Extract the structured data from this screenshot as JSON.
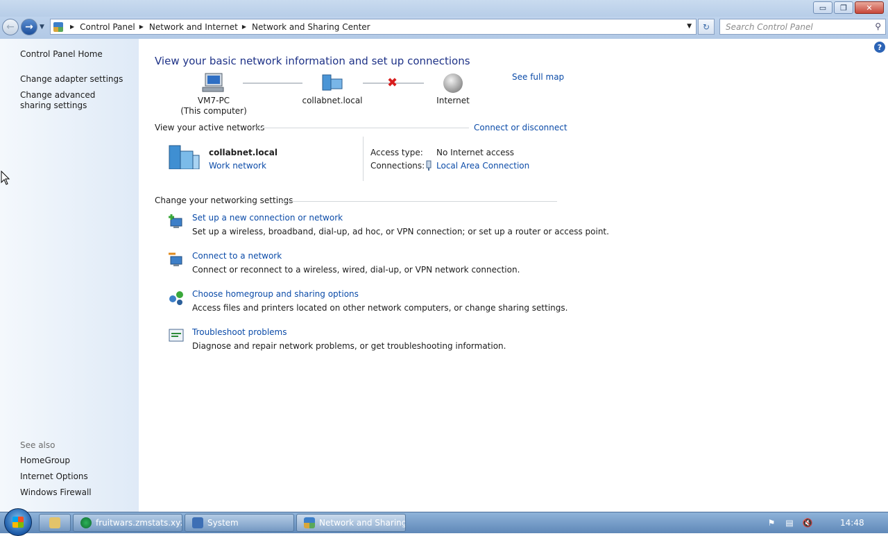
{
  "window": {
    "minimize_glyph": "▭",
    "maximize_glyph": "❐",
    "close_glyph": "✕"
  },
  "addressbar": {
    "crumbs": [
      "Control Panel",
      "Network and Internet",
      "Network and Sharing Center"
    ],
    "search_placeholder": "Search Control Panel"
  },
  "sidebar": {
    "home": "Control Panel Home",
    "items": [
      "Change adapter settings",
      "Change advanced sharing settings"
    ],
    "see_also_label": "See also",
    "see_also": [
      "HomeGroup",
      "Internet Options",
      "Windows Firewall"
    ]
  },
  "main": {
    "title": "View your basic network information and set up connections",
    "see_full_map": "See full map",
    "map": {
      "computer_name": "VM7-PC",
      "computer_sub": "(This computer)",
      "network_name": "collabnet.local",
      "internet": "Internet"
    },
    "active_networks": {
      "heading": "View your active networks",
      "connect_link": "Connect or disconnect",
      "network_name": "collabnet.local",
      "network_type": "Work network",
      "access_type_label": "Access type:",
      "access_type_value": "No Internet access",
      "connections_label": "Connections:",
      "connections_value": "Local Area Connection"
    },
    "settings": {
      "heading": "Change your networking settings",
      "tasks": [
        {
          "title": "Set up a new connection or network",
          "desc": "Set up a wireless, broadband, dial-up, ad hoc, or VPN connection; or set up a router or access point."
        },
        {
          "title": "Connect to a network",
          "desc": "Connect or reconnect to a wireless, wired, dial-up, or VPN network connection."
        },
        {
          "title": "Choose homegroup and sharing options",
          "desc": "Access files and printers located on other network computers, or change sharing settings."
        },
        {
          "title": "Troubleshoot problems",
          "desc": "Diagnose and repair network problems, or get troubleshooting information."
        }
      ]
    }
  },
  "taskbar": {
    "buttons": [
      "fruitwars.zmstats.xyz ...",
      "System",
      "Network and Sharing..."
    ],
    "clock": "14:48"
  },
  "colors": {
    "link": "#0b4ba8",
    "title": "#1e3287",
    "error_x": "#d81e1e"
  }
}
